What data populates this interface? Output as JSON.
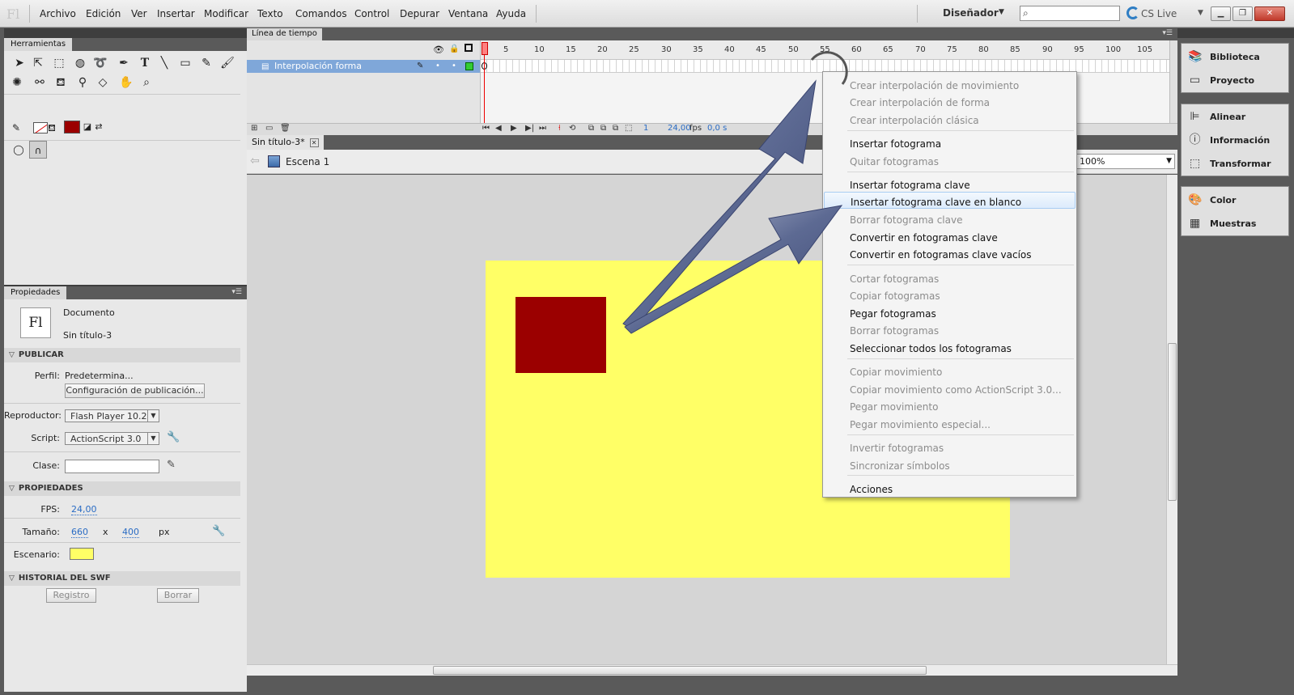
{
  "app": {
    "logo": "Fl",
    "menu": [
      "Archivo",
      "Edición",
      "Ver",
      "Insertar",
      "Modificar",
      "Texto",
      "Comandos",
      "Control",
      "Depurar",
      "Ventana",
      "Ayuda"
    ],
    "workspace": "Diseñador",
    "cs_live": "CS Live",
    "window_buttons": [
      "minimize",
      "restore",
      "close"
    ]
  },
  "tools_panel": {
    "title": "Herramientas",
    "tools": [
      "selection-icon",
      "subselection-icon",
      "free-transform-icon",
      "3d-rotation-icon",
      "lasso-icon",
      "pen-icon",
      "text-icon",
      "line-icon",
      "rectangle-icon",
      "pencil-icon",
      "brush-icon",
      "deco-icon",
      "bone-icon",
      "paint-bucket-icon",
      "eyedropper-icon",
      "eraser-icon",
      "hand-icon",
      "zoom-icon"
    ],
    "stroke_color": "#ff0000",
    "fill_color": "#9b0000"
  },
  "properties": {
    "title": "Propiedades",
    "doc_type": "Documento",
    "doc_name": "Sin título-3",
    "publish": {
      "heading": "PUBLICAR",
      "profile_label": "Perfil:",
      "profile_value": "Predetermina...",
      "config_button": "Configuración de publicación...",
      "player_label": "Reproductor:",
      "player_value": "Flash Player 10.2",
      "script_label": "Script:",
      "script_value": "ActionScript 3.0",
      "class_label": "Clase:"
    },
    "props": {
      "heading": "PROPIEDADES",
      "fps_label": "FPS:",
      "fps_value": "24,00",
      "size_label": "Tamaño:",
      "width": "660",
      "x": "x",
      "height": "400",
      "unit": "px",
      "stage_label": "Escenario:",
      "stage_color": "#ffff66"
    },
    "swf_history": {
      "heading": "HISTORIAL DEL SWF",
      "log_button": "Registro",
      "clear_button": "Borrar"
    }
  },
  "timeline": {
    "title": "Línea de tiempo",
    "layer_name": "Interpolación forma",
    "ticks": [
      "1",
      "5",
      "10",
      "15",
      "20",
      "25",
      "30",
      "35",
      "40",
      "45",
      "50",
      "55",
      "60",
      "65",
      "70",
      "75",
      "80",
      "85",
      "90",
      "95",
      "100",
      "105"
    ],
    "current_frame": "1",
    "fps": "24,00",
    "fps_unit": "fps",
    "time": "0,0 s"
  },
  "document": {
    "tab": "Sin título-3*",
    "scene": "Escena 1",
    "zoom": "100%"
  },
  "dock": {
    "group1": [
      {
        "label": "Biblioteca",
        "icon": "library-icon"
      },
      {
        "label": "Proyecto",
        "icon": "project-icon"
      }
    ],
    "group2": [
      {
        "label": "Alinear",
        "icon": "align-icon"
      },
      {
        "label": "Información",
        "icon": "info-icon"
      },
      {
        "label": "Transformar",
        "icon": "transform-icon"
      }
    ],
    "group3": [
      {
        "label": "Color",
        "icon": "color-icon"
      },
      {
        "label": "Muestras",
        "icon": "swatches-icon"
      }
    ]
  },
  "context_menu": {
    "items": [
      {
        "label": "Crear interpolación de movimiento",
        "enabled": false
      },
      {
        "label": "Crear interpolación de forma",
        "enabled": false
      },
      {
        "label": "Crear interpolación clásica",
        "enabled": false
      },
      {
        "label": "Insertar fotograma",
        "enabled": true
      },
      {
        "label": "Quitar fotogramas",
        "enabled": false
      },
      {
        "label": "Insertar fotograma clave",
        "enabled": true
      },
      {
        "label": "Insertar fotograma clave en blanco",
        "enabled": true,
        "highlighted": true
      },
      {
        "label": "Borrar fotograma clave",
        "enabled": false
      },
      {
        "label": "Convertir en fotogramas clave",
        "enabled": true
      },
      {
        "label": "Convertir en fotogramas clave vacíos",
        "enabled": true
      },
      {
        "label": "Cortar fotogramas",
        "enabled": false
      },
      {
        "label": "Copiar fotogramas",
        "enabled": false
      },
      {
        "label": "Pegar fotogramas",
        "enabled": true
      },
      {
        "label": "Borrar fotogramas",
        "enabled": false
      },
      {
        "label": "Seleccionar todos los fotogramas",
        "enabled": true
      },
      {
        "label": "Copiar movimiento",
        "enabled": false
      },
      {
        "label": "Copiar movimiento como ActionScript 3.0...",
        "enabled": false
      },
      {
        "label": "Pegar movimiento",
        "enabled": false
      },
      {
        "label": "Pegar movimiento especial...",
        "enabled": false
      },
      {
        "label": "Invertir fotogramas",
        "enabled": false
      },
      {
        "label": "Sincronizar símbolos",
        "enabled": false
      },
      {
        "label": "Acciones",
        "enabled": true
      }
    ]
  }
}
